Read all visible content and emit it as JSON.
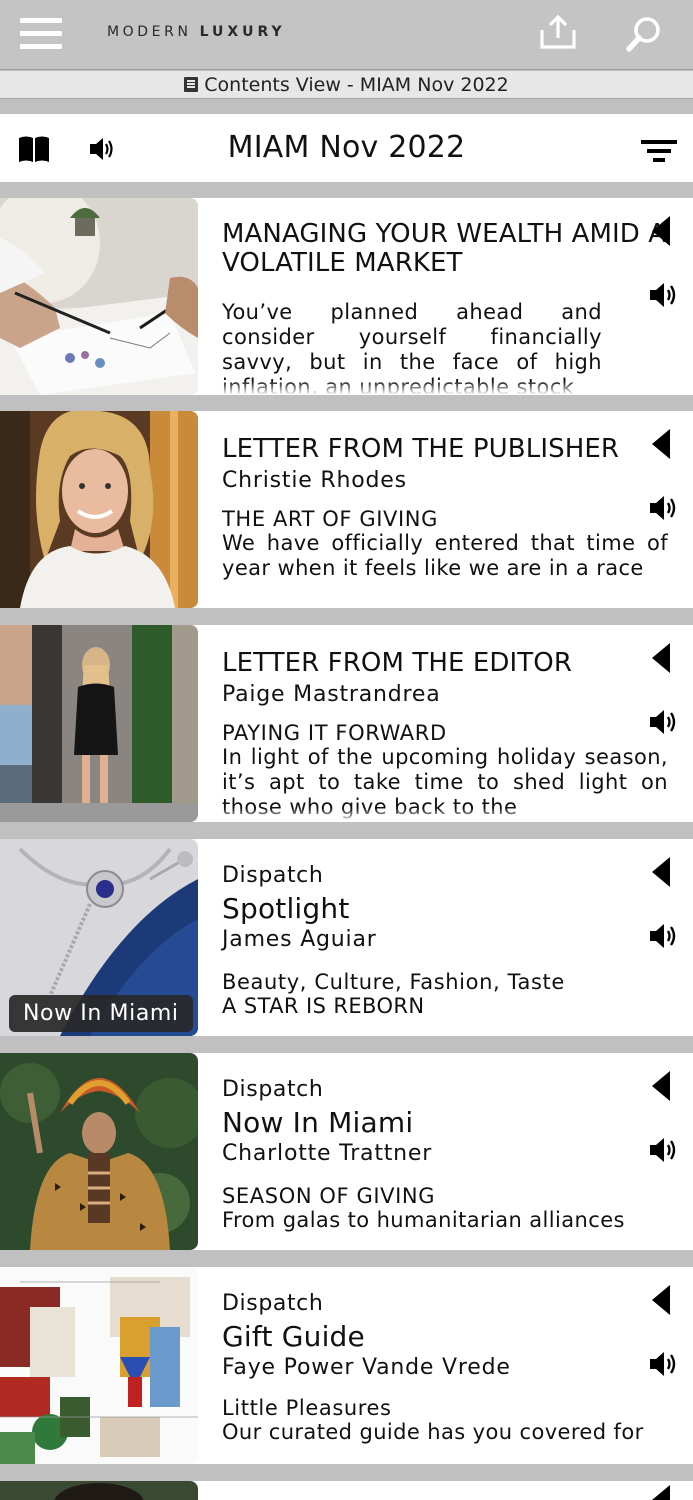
{
  "header": {
    "logo_light": "MODERN",
    "logo_bold": "LUXURY",
    "contents_label": "Contents View - MIAM Nov 2022"
  },
  "titlebar": {
    "title": "MIAM Nov 2022"
  },
  "articles": [
    {
      "title": "MANAGING YOUR WEALTH AMID A VOLATILE MARKET",
      "body": "You’ve planned ahead and consider yourself financially savvy, but in the face of high inflation, an unpredictable stock"
    },
    {
      "title": "LETTER FROM THE PUBLISHER",
      "author": "Christie Rhodes",
      "subtitle": "THE ART OF GIVING",
      "body": "We have officially entered that time of year when it feels like we are in a race"
    },
    {
      "title": "LETTER FROM THE EDITOR",
      "author": "Paige Mastrandrea",
      "subtitle": "PAYING IT FORWARD",
      "body": "In light of the upcoming holiday season, it’s apt to take time to shed light on those who give back to the"
    },
    {
      "section": "Dispatch",
      "heading": "Spotlight",
      "author": "James Aguiar",
      "subtitle": "Beauty, Culture, Fashion, Taste",
      "body": "A STAR IS REBORN",
      "badge": "Now In Miami"
    },
    {
      "section": "Dispatch",
      "heading": "Now In Miami",
      "author": "Charlotte Trattner",
      "subtitle": "SEASON OF GIVING",
      "body": "From galas to humanitarian alliances"
    },
    {
      "section": "Dispatch",
      "heading": "Gift Guide",
      "author": "Faye Power Vande Vrede",
      "subtitle": "Little Pleasures",
      "body": "Our curated guide has you covered for"
    }
  ]
}
